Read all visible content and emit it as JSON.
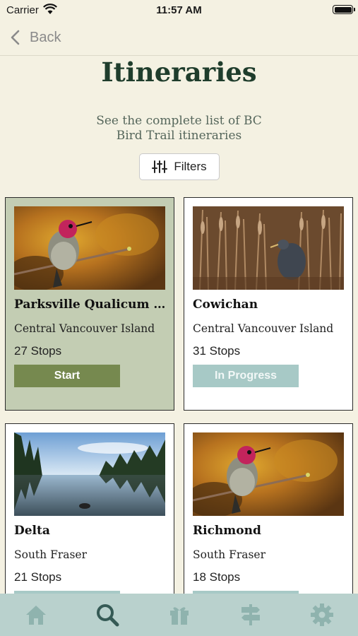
{
  "status_bar": {
    "carrier": "Carrier",
    "time": "11:57 AM"
  },
  "nav": {
    "back_label": "Back"
  },
  "header": {
    "title": "Itineraries",
    "subtitle": "See the complete list of BC Bird Trail itineraries",
    "filters_label": "Filters"
  },
  "colors": {
    "background": "#f4f1e2",
    "title": "#1f3d2c",
    "selected_card": "#c3cdb3",
    "start_button": "#76894f",
    "in_progress_button": "#a7c9c6",
    "tab_bar": "#b9d1cd",
    "tab_icon_inactive": "#8fb3ae",
    "tab_icon_active": "#355a55"
  },
  "itineraries": [
    {
      "title": "Parksville Qualicum B...",
      "region": "Central Vancouver Island",
      "stops": "27 Stops",
      "action": "Start",
      "image": "hummingbird-photo",
      "selected": true
    },
    {
      "title": "Cowichan",
      "region": "Central Vancouver Island",
      "stops": "31 Stops",
      "action": "In Progress",
      "image": "heron-in-reeds-photo",
      "selected": false
    },
    {
      "title": "Delta",
      "region": "South Fraser",
      "stops": "21 Stops",
      "action": "",
      "image": "forest-lake-photo",
      "selected": false
    },
    {
      "title": "Richmond",
      "region": "South Fraser",
      "stops": "18 Stops",
      "action": "",
      "image": "hummingbird-photo",
      "selected": false
    }
  ],
  "tabs": [
    {
      "name": "home",
      "icon": "home-icon",
      "active": false
    },
    {
      "name": "search",
      "icon": "search-icon",
      "active": true
    },
    {
      "name": "rewards",
      "icon": "gift-icon",
      "active": false
    },
    {
      "name": "trails",
      "icon": "signpost-icon",
      "active": false
    },
    {
      "name": "settings",
      "icon": "gear-icon",
      "active": false
    }
  ]
}
